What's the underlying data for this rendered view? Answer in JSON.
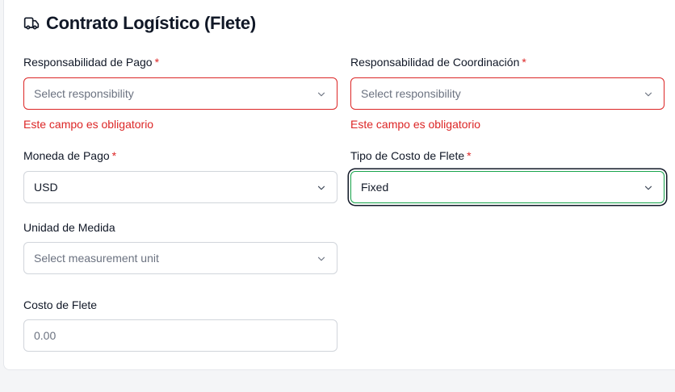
{
  "header": {
    "icon": "truck-icon",
    "title": "Contrato Logístico (Flete)"
  },
  "form": {
    "payment_responsibility": {
      "label": "Responsabilidad de Pago",
      "required_mark": "*",
      "placeholder": "Select responsibility",
      "error": "Este campo es obligatorio"
    },
    "coordination_responsibility": {
      "label": "Responsabilidad de Coordinación",
      "required_mark": "*",
      "placeholder": "Select responsibility",
      "error": "Este campo es obligatorio"
    },
    "payment_currency": {
      "label": "Moneda de Pago",
      "required_mark": "*",
      "value": "USD"
    },
    "freight_cost_type": {
      "label": "Tipo de Costo de Flete",
      "required_mark": "*",
      "value": "Fixed"
    },
    "measurement_unit": {
      "label": "Unidad de Medida",
      "placeholder": "Select measurement unit"
    },
    "freight_cost": {
      "label": "Costo de Flete",
      "placeholder": "0.00"
    }
  },
  "colors": {
    "error": "#dc2626",
    "focus_border": "#16a34a",
    "focus_ring": "#111827"
  }
}
